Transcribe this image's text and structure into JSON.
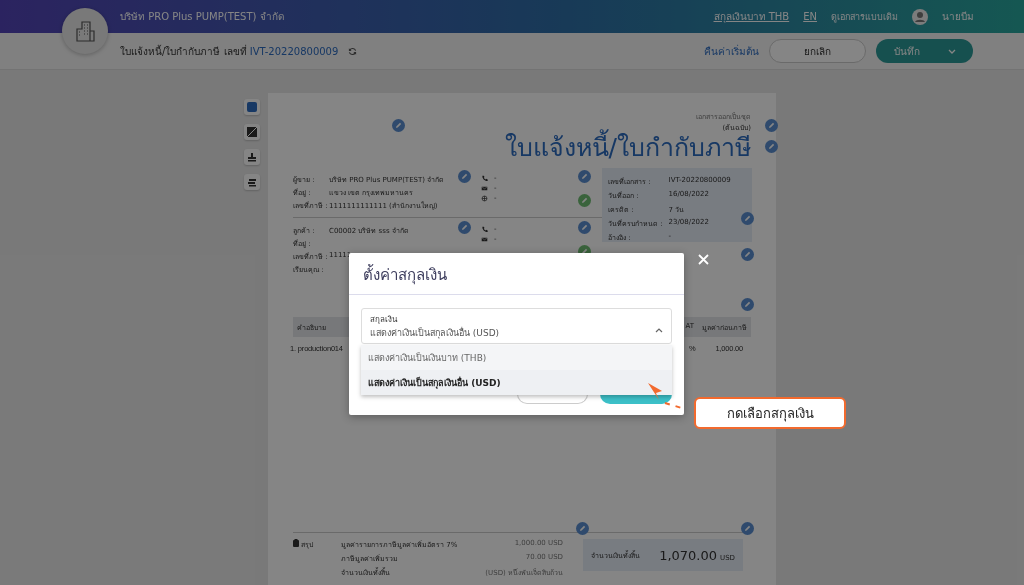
{
  "header": {
    "company": "บริษัท PRO Plus PUMP(TEST) จำกัด",
    "currency_link": "สกุลเงินบาท THB",
    "language": "EN",
    "old_doc_link": "ดูเอกสารแบบเดิม",
    "user": "นายบีม"
  },
  "toolbar": {
    "title_prefix": "ใบแจ้งหนี้/ใบกำกับภาษี เลขที่",
    "doc_number": "IVT-20220800009",
    "reset": "คืนค่าเริ่มต้น",
    "cancel": "ยกเลิก",
    "save": "บันทึก"
  },
  "document": {
    "copy_note": "เอกสารออกเป็นชุด",
    "copy_type": "(ต้นฉบับ)",
    "title": "ใบแจ้งหนี้/ใบกำกับภาษี",
    "seller": [
      {
        "label": "ผู้ขาย :",
        "value": "บริษัท PRO Plus PUMP(TEST) จำกัด"
      },
      {
        "label": "ที่อยู่ :",
        "value": "แขวง เขต กรุงเทพมหานคร"
      },
      {
        "label": "เลขที่ภาษี :",
        "value": "1111111111111 (สำนักงานใหญ่)"
      }
    ],
    "seller_contacts": [
      {
        "kind": "phone",
        "value": "-"
      },
      {
        "kind": "email",
        "value": "-"
      },
      {
        "kind": "web",
        "value": "-"
      }
    ],
    "customer": [
      {
        "label": "ลูกค้า :",
        "value": "C00002 บริษัท sss จำกัด"
      },
      {
        "label": "ที่อยู่ :"
      },
      {
        "label": "เลขที่ภาษี :",
        "value": "11111"
      },
      {
        "label": "เรียนคุณ :"
      }
    ],
    "customer_contacts": [
      {
        "kind": "phone",
        "value": "-"
      },
      {
        "kind": "email",
        "value": "-"
      }
    ],
    "info": [
      {
        "label": "เลขที่เอกสาร :",
        "value": "IVT-20220800009"
      },
      {
        "label": "วันที่ออก :",
        "value": "16/08/2022"
      },
      {
        "label": "เครดิต :",
        "value": "7 วัน"
      },
      {
        "label": "วันที่ครบกำหนด :",
        "value": "23/08/2022"
      },
      {
        "label": "อ้างอิง :",
        "value": "-"
      }
    ],
    "table": {
      "columns": [
        "คำอธิบาย",
        "AT",
        "มูลค่าก่อนภาษี"
      ],
      "rows": [
        {
          "index": "1.",
          "description": "production014",
          "vat": "%",
          "amount": "1,000.00"
        }
      ]
    },
    "summary": {
      "heading": "สรุป",
      "rows": [
        {
          "label": "มูลค่ารายการภาษีมูลค่าเพิ่มอัตรา 7%",
          "value": "1,000.00 USD"
        },
        {
          "label": "ภาษีมูลค่าเพิ่มรวม",
          "value": "70.00 USD"
        },
        {
          "label": "จำนวนเงินทั้งสิ้น",
          "value": "(USD) หนึ่งพันเจ็ดสิบถ้วน"
        }
      ],
      "total_label": "จำนวนเงินทั้งสิ้น",
      "total_value": "1,070.00",
      "total_unit": "USD"
    }
  },
  "modal": {
    "title": "ตั้งค่าสกุลเงิน",
    "field_label": "สกุลเงิน",
    "value": "แสดงค่าเงินเป็นสกุลเงินอื่น (USD)",
    "expanded": true,
    "options": [
      {
        "label": "แสดงค่าเงินเป็นเงินบาท (THB)",
        "selected": false
      },
      {
        "label": "แสดงค่าเงินเป็นสกุลเงินอื่น (USD)",
        "selected": true
      }
    ],
    "callout": "กดเลือกสกุลเงิน"
  }
}
